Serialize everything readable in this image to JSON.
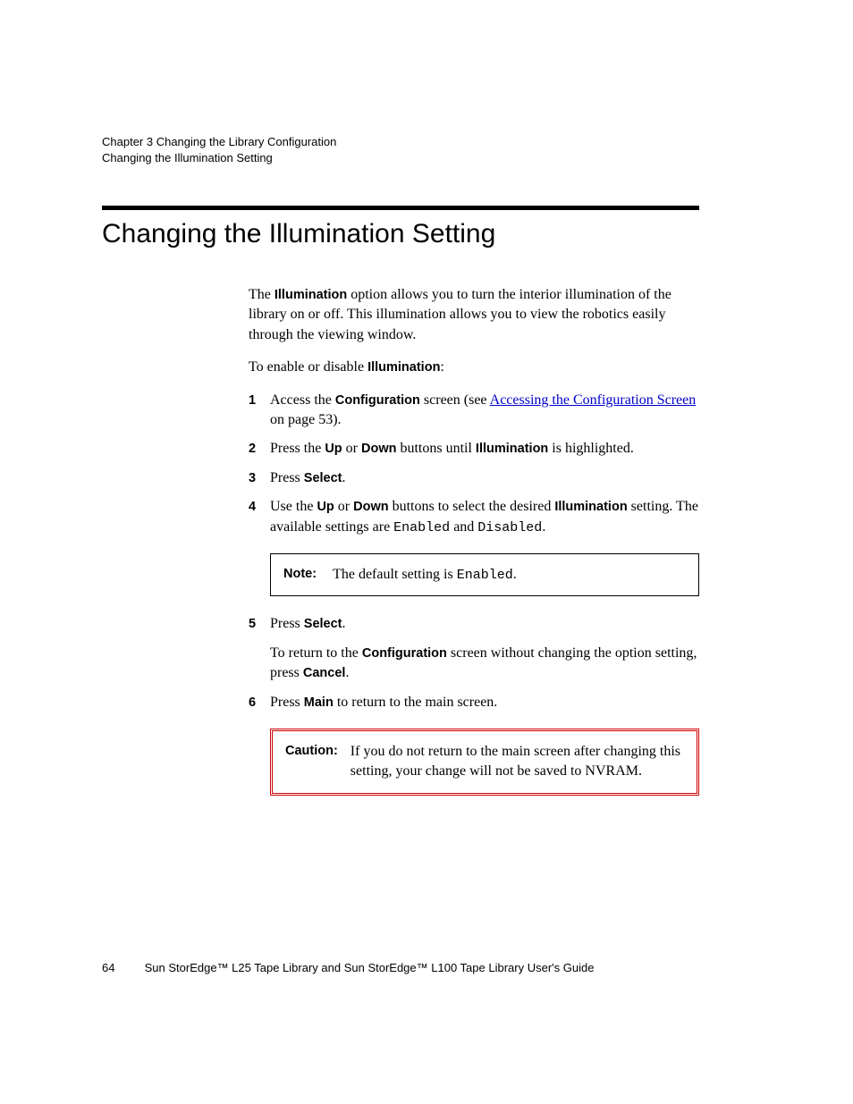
{
  "header": {
    "chapter_line": "Chapter 3  Changing the Library Configuration",
    "section_line": "Changing the Illumination Setting"
  },
  "title": "Changing the Illumination Setting",
  "intro": {
    "p1_a": "The ",
    "p1_b": "Illumination",
    "p1_c": " option allows you to turn the interior illumination of the library on or off. This illumination allows you to view the robotics easily through the viewing window.",
    "p2_a": "To enable or disable ",
    "p2_b": "Illumination",
    "p2_c": ":"
  },
  "steps": {
    "s1": {
      "num": "1",
      "a": "Access the ",
      "b": "Configuration",
      "c": " screen (see ",
      "link1": "Accessing the ",
      "link2": "Configuration Screen",
      "d": " on page 53)."
    },
    "s2": {
      "num": "2",
      "a": "Press the ",
      "b": "Up",
      "c": " or ",
      "d": "Down",
      "e": " buttons until ",
      "f": "Illumination",
      "g": " is highlighted."
    },
    "s3": {
      "num": "3",
      "a": "Press ",
      "b": "Select",
      "c": "."
    },
    "s4": {
      "num": "4",
      "a": "Use the ",
      "b": "Up",
      "c": " or ",
      "d": "Down",
      "e": " buttons to select the desired ",
      "f": "Illumination",
      "g": " setting. The available settings are ",
      "h": "Enabled",
      "i": " and ",
      "j": "Disabled",
      "k": "."
    },
    "note": {
      "label": "Note:",
      "a": "The default setting is ",
      "b": "Enabled",
      "c": "."
    },
    "s5": {
      "num": "5",
      "a": "Press ",
      "b": "Select",
      "c": ".",
      "ret_a": "To return to the ",
      "ret_b": "Configuration",
      "ret_c": " screen without changing the option setting, press ",
      "ret_d": "Cancel",
      "ret_e": "."
    },
    "s6": {
      "num": "6",
      "a": "Press ",
      "b": "Main",
      "c": " to return to the main screen."
    },
    "caution": {
      "label": "Caution:",
      "text": "If you do not return to the main screen after changing this setting, your change will not be saved to NVRAM."
    }
  },
  "footer": {
    "page": "64",
    "text": "Sun StorEdge™ L25 Tape Library and Sun StorEdge™ L100 Tape Library User's Guide"
  }
}
